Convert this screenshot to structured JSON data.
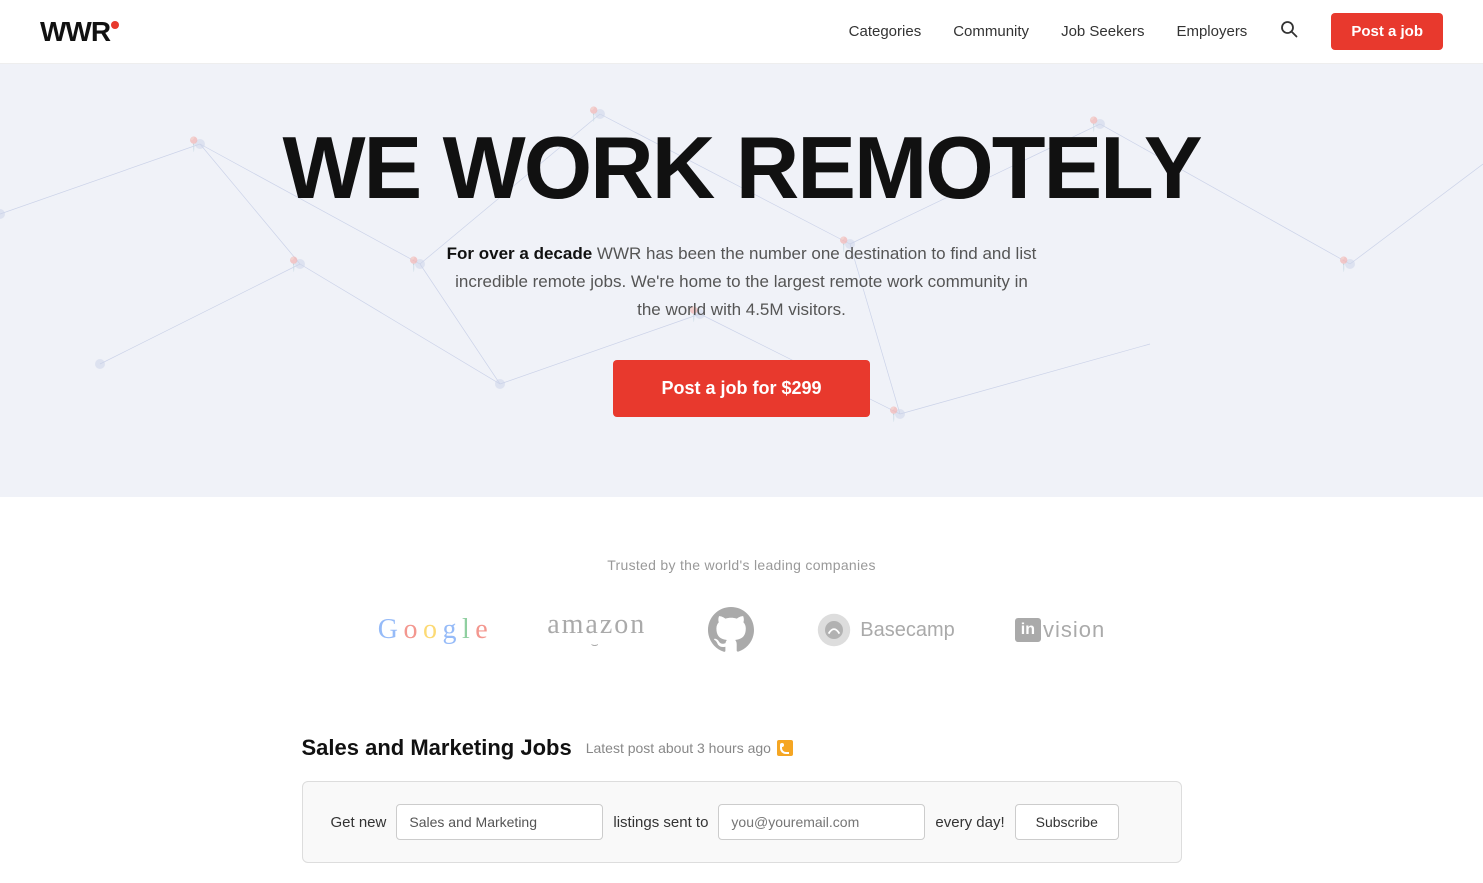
{
  "nav": {
    "logo_text": "WWR",
    "links": [
      {
        "label": "Categories",
        "name": "categories-link"
      },
      {
        "label": "Community",
        "name": "community-link"
      },
      {
        "label": "Job Seekers",
        "name": "job-seekers-link"
      },
      {
        "label": "Employers",
        "name": "employers-link"
      }
    ],
    "post_job_label": "Post a job"
  },
  "hero": {
    "headline": "WE WORK REMOTELY",
    "description_bold": "For over a decade",
    "description_rest": " WWR has been the number one destination to find and list incredible remote jobs. We're home to the largest remote work community in the world with 4.5M visitors.",
    "cta_label": "Post a job for $299"
  },
  "trusted": {
    "label": "Trusted by the world's leading companies",
    "companies": [
      {
        "name": "Google"
      },
      {
        "name": "amazon"
      },
      {
        "name": "GitHub"
      },
      {
        "name": "Basecamp"
      },
      {
        "name": "InVision"
      }
    ]
  },
  "jobs": {
    "section_title": "Sales and Marketing Jobs",
    "latest_post": "Latest post about 3 hours ago",
    "subscribe": {
      "get_new": "Get new",
      "category_value": "Sales and Marketing",
      "listings_sent_to": "listings sent to",
      "email_placeholder": "you@youremail.com",
      "every_day": "every day!",
      "subscribe_label": "Subscribe"
    }
  }
}
